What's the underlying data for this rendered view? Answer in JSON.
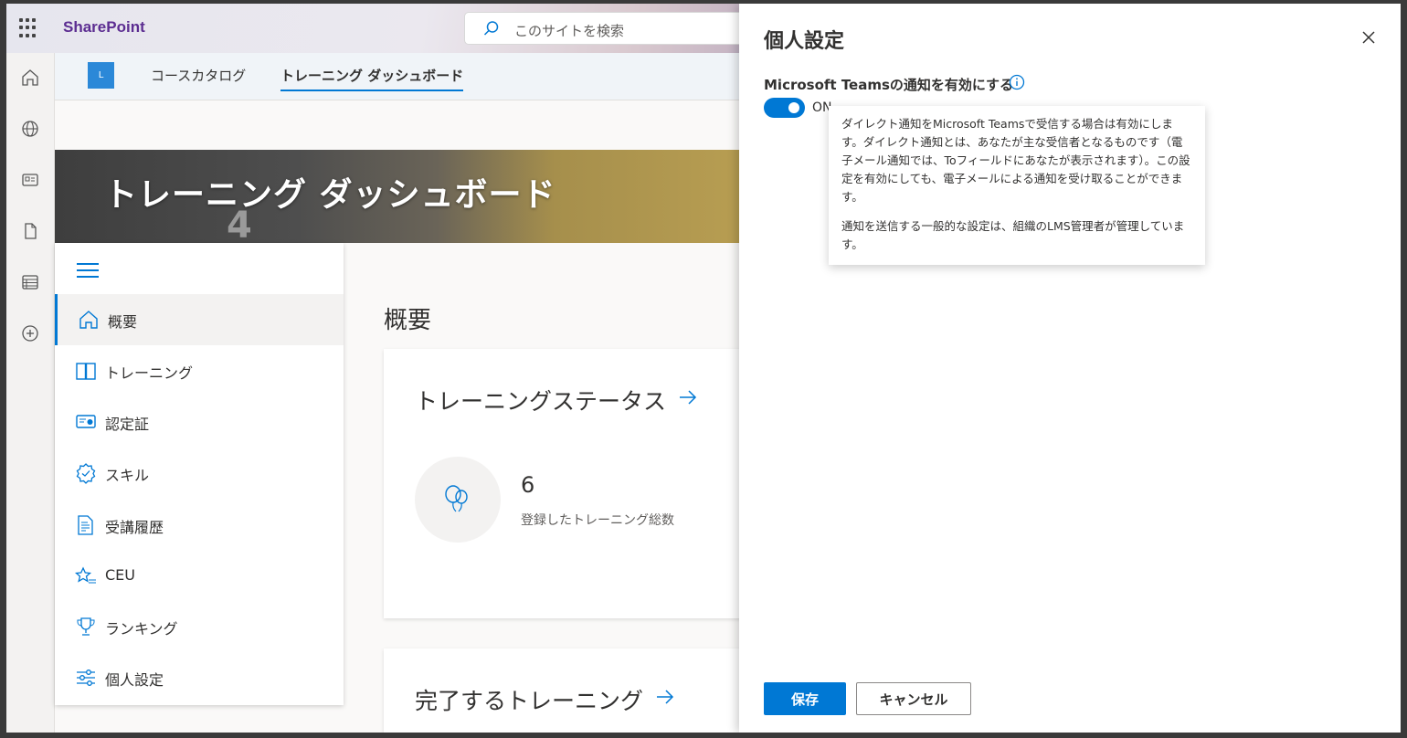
{
  "suite": {
    "brand": "SharePoint",
    "search_placeholder": "このサイトを検索"
  },
  "rail": {
    "icons": [
      "home-icon",
      "globe-icon",
      "news-icon",
      "file-icon",
      "list-icon",
      "add-icon"
    ]
  },
  "site": {
    "logo_letter": "L",
    "nav": [
      {
        "label": "コースカタログ",
        "active": false
      },
      {
        "label": "トレーニング ダッシュボード",
        "active": true
      }
    ]
  },
  "hero": {
    "title": "トレーニング ダッシュボード",
    "deco_digit": "4"
  },
  "leftnav": {
    "items": [
      {
        "label": "概要",
        "icon": "home-icon",
        "active": true
      },
      {
        "label": "トレーニング",
        "icon": "book-icon",
        "active": false
      },
      {
        "label": "認定証",
        "icon": "certificate-icon",
        "active": false
      },
      {
        "label": "スキル",
        "icon": "badge-icon",
        "active": false
      },
      {
        "label": "受講履歴",
        "icon": "history-icon",
        "active": false
      },
      {
        "label": "CEU",
        "icon": "star-list-icon",
        "active": false
      },
      {
        "label": "ランキング",
        "icon": "trophy-icon",
        "active": false
      },
      {
        "label": "個人設定",
        "icon": "settings-sliders-icon",
        "active": false
      }
    ]
  },
  "main": {
    "heading": "概要",
    "status_card": {
      "title": "トレーニングステータス",
      "count": "6",
      "count_label": "登録したトレーニング総数"
    },
    "complete_card": {
      "title": "完了するトレーニング"
    }
  },
  "panel": {
    "title": "個人設定",
    "setting_label": "Microsoft Teamsの通知を有効にする",
    "toggle_state": "ON",
    "tooltip": {
      "p1": "ダイレクト通知をMicrosoft Teamsで受信する場合は有効にします。ダイレクト通知とは、あなたが主な受信者となるものです（電子メール通知では、Toフィールドにあなたが表示されます）。この設定を有効にしても、電子メールによる通知を受け取ることができます。",
      "p2": "通知を送信する一般的な設定は、組織のLMS管理者が管理しています。"
    },
    "save_label": "保存",
    "cancel_label": "キャンセル"
  },
  "colors": {
    "accent": "#0078d4",
    "brand": "#5c2d91"
  }
}
